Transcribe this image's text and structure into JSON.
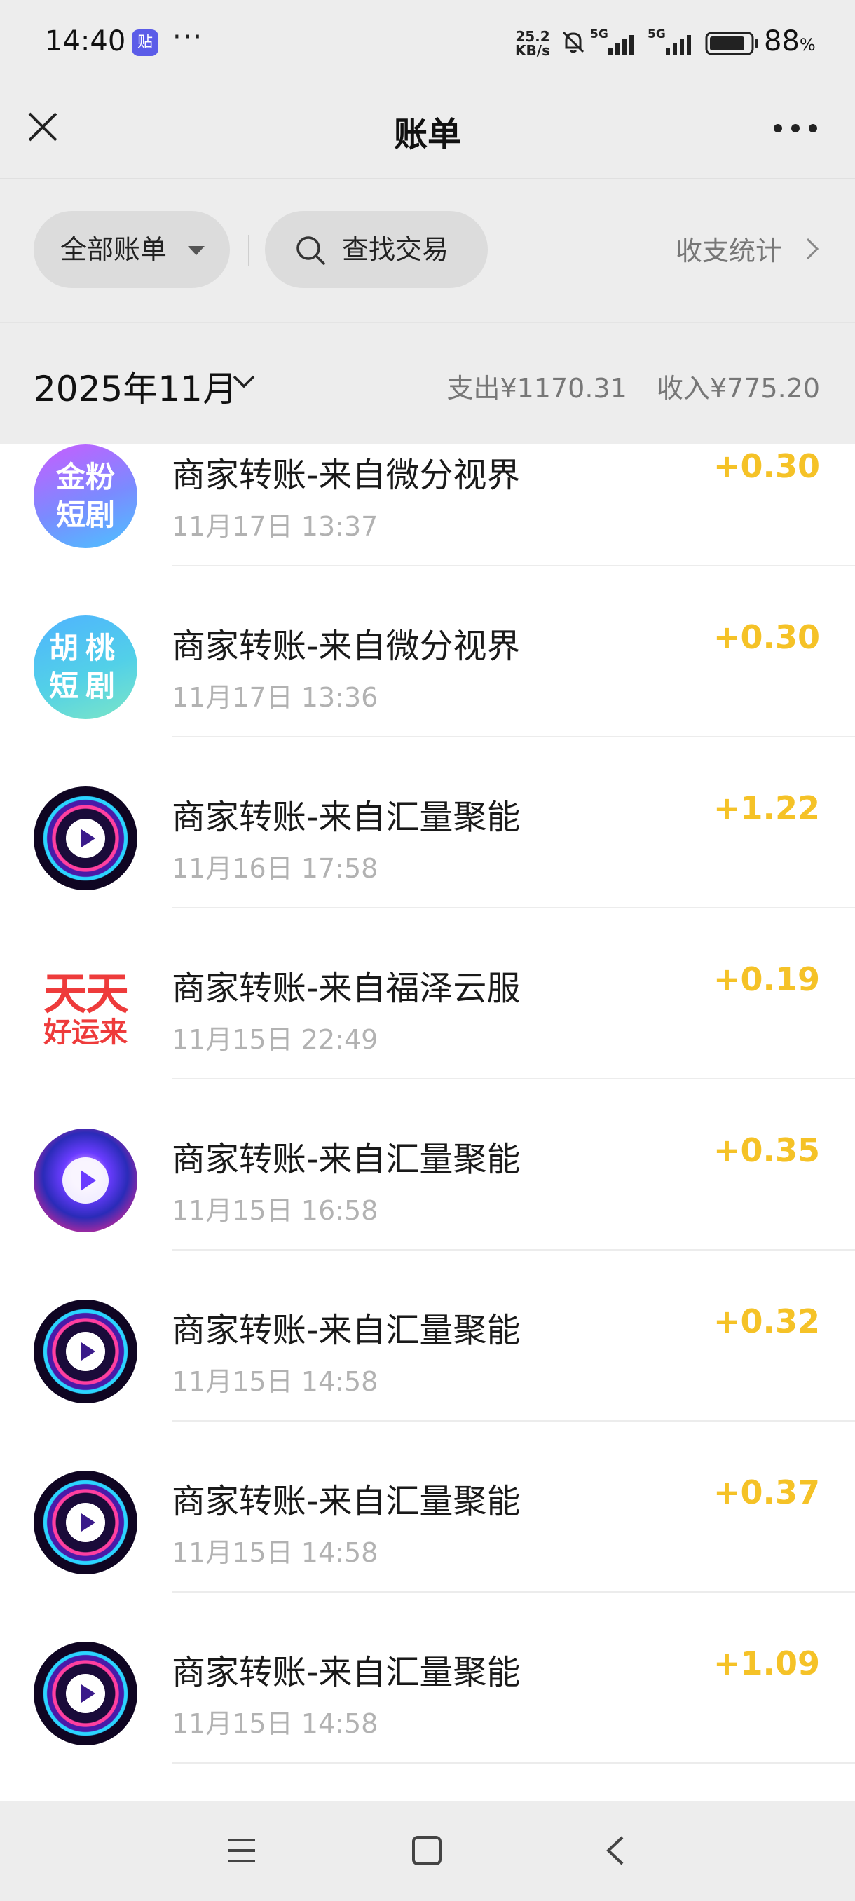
{
  "status_bar": {
    "time": "14:40",
    "app_badge": "贴",
    "dots": "···",
    "net_speed_value": "25.2",
    "net_speed_unit": "KB/s",
    "battery_percent": "88",
    "battery_unit": "%",
    "battery_level": 0.88,
    "signal_label_1": "5G",
    "signal_label_2": "5G"
  },
  "header": {
    "title": "账单"
  },
  "filters": {
    "all_bills_label": "全部账单",
    "search_label": "查找交易",
    "stats_label": "收支统计"
  },
  "month_bar": {
    "month": "2025年11月",
    "expense": "支出¥1170.31",
    "income": "收入¥775.20"
  },
  "transactions": [
    {
      "title": "商家转账-来自微分视界",
      "time": "11月17日 13:37",
      "amount": "+0.30",
      "avatar": "jinfen",
      "avatar_text_1": "金粉",
      "avatar_text_2": "短剧"
    },
    {
      "title": "商家转账-来自微分视界",
      "time": "11月17日 13:36",
      "amount": "+0.30",
      "avatar": "hutao",
      "avatar_text_1": "胡桃",
      "avatar_text_2": "短剧"
    },
    {
      "title": "商家转账-来自汇量聚能",
      "time": "11月16日 17:58",
      "amount": "+1.22",
      "avatar": "ring-play"
    },
    {
      "title": "商家转账-来自福泽云服",
      "time": "11月15日 22:49",
      "amount": "+0.19",
      "avatar": "tiantian",
      "avatar_text_1": "天天",
      "avatar_text_2": "好运来"
    },
    {
      "title": "商家转账-来自汇量聚能",
      "time": "11月15日 16:58",
      "amount": "+0.35",
      "avatar": "burst-play"
    },
    {
      "title": "商家转账-来自汇量聚能",
      "time": "11月15日 14:58",
      "amount": "+0.32",
      "avatar": "ring-play"
    },
    {
      "title": "商家转账-来自汇量聚能",
      "time": "11月15日 14:58",
      "amount": "+0.37",
      "avatar": "ring-play"
    },
    {
      "title": "商家转账-来自汇量聚能",
      "time": "11月15日 14:58",
      "amount": "+1.09",
      "avatar": "ring-play"
    }
  ],
  "colors": {
    "amount": "#f5c227",
    "background_gray": "#ededed",
    "muted_text": "#777777"
  },
  "icons": {
    "close": "close-icon",
    "more": "more-icon",
    "dropdown": "caret-down-icon",
    "search": "search-icon",
    "chevron_right": "chevron-right-icon",
    "chevron_down": "chevron-down-icon",
    "nav_menu": "menu-icon",
    "nav_home": "home-icon",
    "nav_back": "back-icon"
  }
}
